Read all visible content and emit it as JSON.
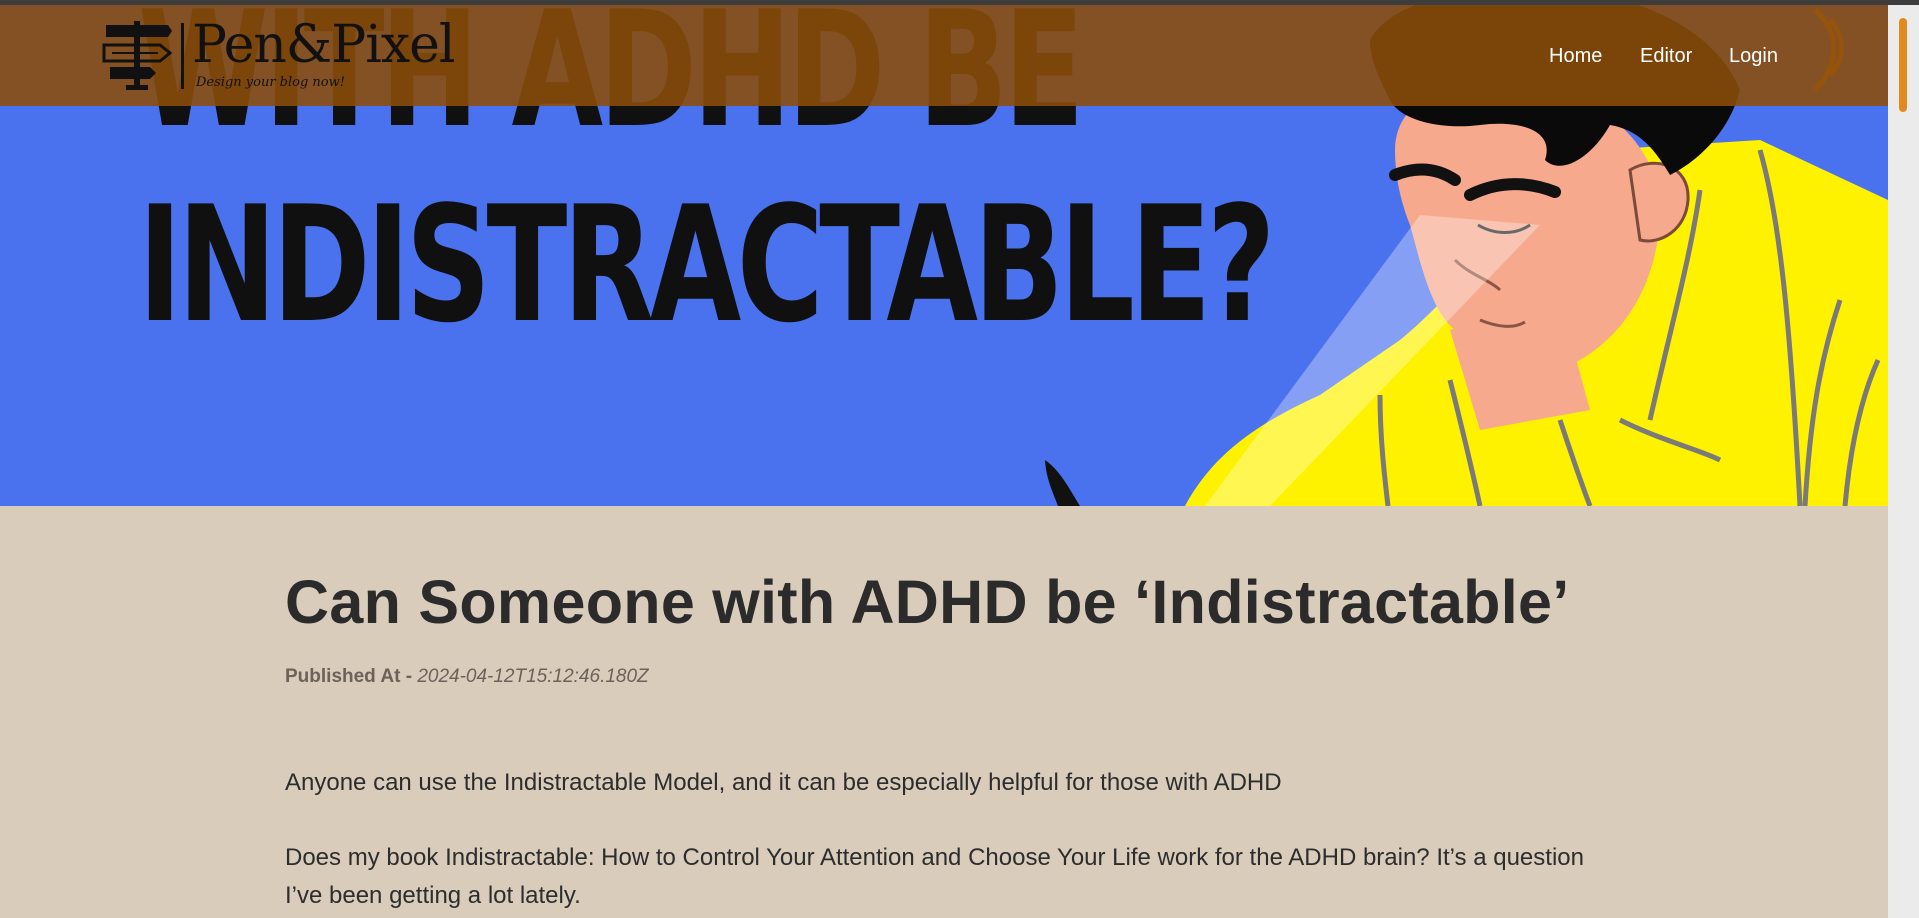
{
  "brand": {
    "name": "Pen&Pixel",
    "tagline": "Design your blog now!"
  },
  "nav": {
    "links": [
      "Home",
      "Editor",
      "Login"
    ]
  },
  "hero": {
    "line1": "WITH ADHD BE",
    "line2": "INDISTRACTABLE?"
  },
  "post": {
    "title": "Can Someone with ADHD be ‘Indistractable’",
    "published_label": "Published At -",
    "published_at": "2024-04-12T15:12:46.180Z",
    "paragraphs": [
      "Anyone can use the Indistractable Model, and it can be especially helpful for those with ADHD",
      "Does my book Indistractable: How to Control Your Attention and Choose Your Life work for the ADHD brain? It’s a question I’ve been getting a lot lately."
    ]
  },
  "colors": {
    "navbar": "#8b4c08",
    "hero_blue": "#4a72ef",
    "hero_yellow": "#fff200",
    "page_background": "#d9ccbb",
    "scrollbar_thumb": "#e08a1e"
  }
}
